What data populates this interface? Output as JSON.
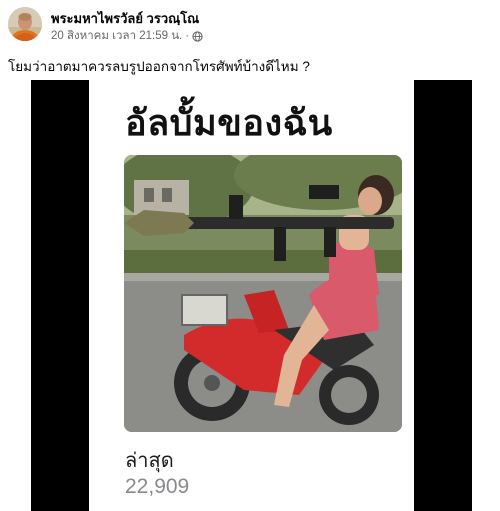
{
  "post": {
    "author_name": "พระมหาไพรวัลย์ วรวณฺโณ",
    "timestamp": "20 สิงหาคม เวลา 21:59 น.",
    "separator": "·",
    "privacy_icon": "globe-icon",
    "caption": "โยมว่าอาตมาควรลบรูปออกจากโทรศัพท์บ้างดีไหม ?"
  },
  "album": {
    "title": "อัลบั้มของฉัน",
    "recent_label": "ล่าสุด",
    "recent_count": "22,909"
  },
  "colors": {
    "name_text": "#050505",
    "meta_text": "#65676b",
    "media_background": "#000000",
    "count_text": "#8a8a8e"
  }
}
